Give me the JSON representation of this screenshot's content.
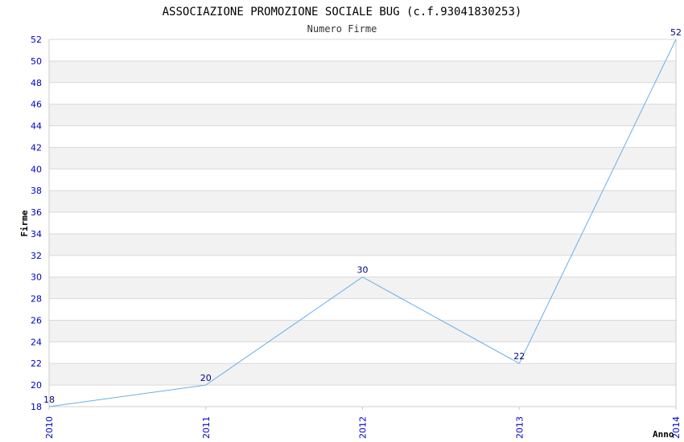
{
  "chart_data": {
    "type": "line",
    "title": "ASSOCIAZIONE PROMOZIONE SOCIALE BUG (c.f.93041830253)",
    "subtitle": "Numero Firme",
    "xlabel": "Anno",
    "ylabel": "Firme",
    "x": [
      "2010",
      "2011",
      "2012",
      "2013",
      "2014"
    ],
    "series": [
      {
        "values": [
          18,
          20,
          30,
          22,
          52
        ],
        "data_labels": [
          "18",
          "20",
          "30",
          "22",
          "52"
        ]
      }
    ],
    "ylim": [
      18,
      52
    ],
    "y_ticks": [
      "18",
      "20",
      "22",
      "24",
      "26",
      "28",
      "30",
      "32",
      "34",
      "36",
      "38",
      "40",
      "42",
      "44",
      "46",
      "48",
      "50",
      "52"
    ],
    "grid": true,
    "legend": "none",
    "colors": {
      "line": "#6aaee8",
      "tick_label": "#0000cc",
      "data_label": "#000080",
      "band_alt": "#f2f2f2",
      "band": "#ffffff",
      "grid": "#d9d9d9",
      "axis": "#cccccc"
    }
  }
}
